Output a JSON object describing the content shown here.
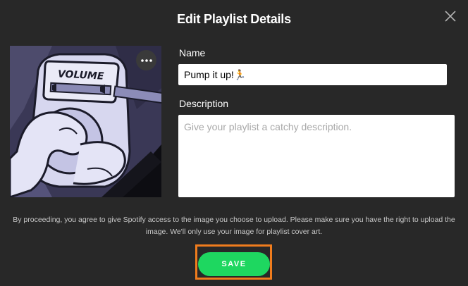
{
  "dialog": {
    "title": "Edit Playlist Details",
    "close_icon": "close-icon"
  },
  "cover": {
    "screen_text": "VOLUME",
    "more_icon": "more-options-icon"
  },
  "fields": {
    "name_label": "Name",
    "name_value": "Pump it up!🏃",
    "description_label": "Description",
    "description_placeholder": "Give your playlist a catchy description."
  },
  "disclaimer": "By proceeding, you agree to give Spotify access to the image you choose to upload. Please make sure you have the right to upload the image. We'll only use your image for playlist cover art.",
  "actions": {
    "save_label": "SAVE"
  },
  "colors": {
    "background": "#282828",
    "accent": "#1ed760",
    "highlight": "#f07c1d"
  }
}
